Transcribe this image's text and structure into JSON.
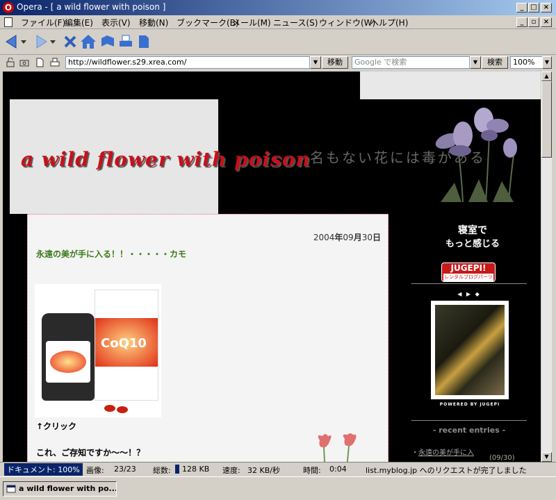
{
  "window": {
    "title": "Opera - [ a wild flower with poison ]"
  },
  "menu": [
    "ファイル(F)",
    "編集(E)",
    "表示(V)",
    "移動(N)",
    "ブックマーク(B)",
    "メール(M)",
    "ニュース(S)",
    "ウィンドウ(W)",
    "ヘルプ(H)"
  ],
  "address": {
    "url": "http://wildflower.s29.xrea.com/",
    "go_label": "移動",
    "search_placeholder": "Google で検索",
    "search_button": "検索",
    "zoom": "100%"
  },
  "page": {
    "banner_title": "a wild flower with poison",
    "banner_subtitle": "名もない花には毒がある",
    "post": {
      "date_year": "2004",
      "year_unit": "年",
      "date_month": "09",
      "month_unit": "月",
      "date_day": "30",
      "day_unit": "日",
      "title": "永遠の美が手に入る！！・・・・・カモ",
      "product_logo": "CoQ10",
      "click_text": "↑クリック",
      "line1": "これ、ご存知ですか～～！？"
    },
    "sidebar": {
      "ad_line1": "寝室で",
      "ad_line2": "もっと感じる",
      "jugem_logo": "JUGEPI!",
      "jugem_sub": "レンタルブログパーツ",
      "controls": "◀ ▶ ◆",
      "powered": "POWERED BY JUGEPI",
      "recent_title": "- recent entries -",
      "recent_item": "永遠の美が手に入",
      "recent_date": "(09/30)"
    }
  },
  "status": {
    "doc_label": "ドキュメント:",
    "doc_value": "100%",
    "img_label": "画像:",
    "img_value": "23/23",
    "total_label": "総数:",
    "total_value": "128 KB",
    "speed_label": "速度:",
    "speed_value": "32 KB/秒",
    "time_label": "時間:",
    "time_value": "0:04",
    "message": "list.myblog.jp へのリクエストが完了しました"
  },
  "taskbar": {
    "label": "a wild flower with po..."
  },
  "colors": {
    "title_bar": "#0a246a",
    "post_title": "#3a7a1a",
    "banner_text": "#c8101a",
    "post_border": "#e06080"
  }
}
